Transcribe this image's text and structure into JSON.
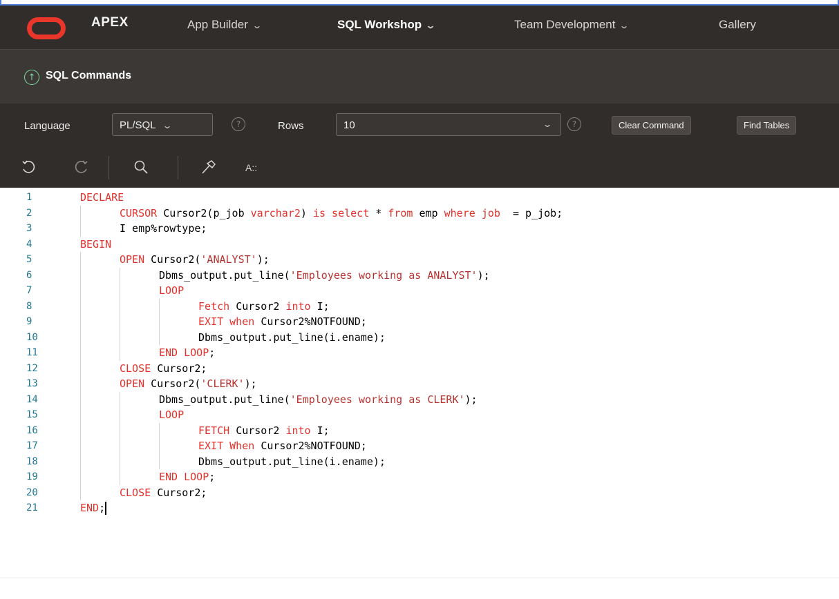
{
  "nav": {
    "brand": "APEX",
    "items": [
      {
        "label": "App Builder",
        "has_menu": true
      },
      {
        "label": "SQL Workshop",
        "has_menu": true,
        "active": true
      },
      {
        "label": "Team Development",
        "has_menu": true
      },
      {
        "label": "Gallery",
        "has_menu": false
      }
    ]
  },
  "page": {
    "title": "SQL Commands"
  },
  "options": {
    "language_label": "Language",
    "language_value": "PL/SQL",
    "rows_label": "Rows",
    "rows_value": "10",
    "help_glyph": "?",
    "clear_button": "Clear Command",
    "find_tables_button": "Find Tables"
  },
  "editor_toolbar": {
    "icons": [
      "undo-icon",
      "redo-icon",
      "search-icon",
      "hammer-icon",
      "text-format-icon"
    ],
    "format_label": "A::"
  },
  "editor": {
    "lines": [
      {
        "n": "1",
        "indent": 0,
        "tokens": [
          [
            "kw",
            "DECLARE"
          ]
        ]
      },
      {
        "n": "2",
        "indent": 1,
        "tokens": [
          [
            "kw",
            "CURSOR "
          ],
          [
            "plain",
            "Cursor2(p_job "
          ],
          [
            "kw",
            "varchar2"
          ],
          [
            "plain",
            ") "
          ],
          [
            "kw",
            "is select"
          ],
          [
            "plain",
            " * "
          ],
          [
            "kw",
            "from"
          ],
          [
            "plain",
            " emp "
          ],
          [
            "kw",
            "where"
          ],
          [
            "plain",
            " "
          ],
          [
            "kw",
            "job"
          ],
          [
            "plain",
            "  = p_job;"
          ]
        ]
      },
      {
        "n": "3",
        "indent": 1,
        "tokens": [
          [
            "plain",
            "I emp%rowtype;"
          ]
        ]
      },
      {
        "n": "4",
        "indent": 0,
        "tokens": [
          [
            "kw",
            "BEGIN"
          ]
        ]
      },
      {
        "n": "5",
        "indent": 1,
        "tokens": [
          [
            "kw",
            "OPEN "
          ],
          [
            "plain",
            "Cursor2("
          ],
          [
            "str",
            "'ANALYST'"
          ],
          [
            "plain",
            ");"
          ]
        ]
      },
      {
        "n": "6",
        "indent": 2,
        "tokens": [
          [
            "plain",
            "Dbms_output.put_line("
          ],
          [
            "str",
            "'Employees working as ANALYST'"
          ],
          [
            "plain",
            ");"
          ]
        ]
      },
      {
        "n": "7",
        "indent": 2,
        "tokens": [
          [
            "kw",
            "LOOP"
          ]
        ]
      },
      {
        "n": "8",
        "indent": 3,
        "tokens": [
          [
            "kw",
            "Fetch "
          ],
          [
            "plain",
            "Cursor2 "
          ],
          [
            "kw",
            "into"
          ],
          [
            "plain",
            " I;"
          ]
        ]
      },
      {
        "n": "9",
        "indent": 3,
        "tokens": [
          [
            "kw",
            "EXIT when "
          ],
          [
            "plain",
            "Cursor2%NOTFOUND;"
          ]
        ]
      },
      {
        "n": "10",
        "indent": 3,
        "tokens": [
          [
            "plain",
            "Dbms_output.put_line(i.ename);"
          ]
        ]
      },
      {
        "n": "11",
        "indent": 2,
        "tokens": [
          [
            "kw",
            "END LOOP"
          ],
          [
            "plain",
            ";"
          ]
        ]
      },
      {
        "n": "12",
        "indent": 1,
        "tokens": [
          [
            "kw",
            "CLOSE "
          ],
          [
            "plain",
            "Cursor2;"
          ]
        ]
      },
      {
        "n": "13",
        "indent": 1,
        "tokens": [
          [
            "kw",
            "OPEN "
          ],
          [
            "plain",
            "Cursor2("
          ],
          [
            "str",
            "'CLERK'"
          ],
          [
            "plain",
            ");"
          ]
        ]
      },
      {
        "n": "14",
        "indent": 2,
        "tokens": [
          [
            "plain",
            "Dbms_output.put_line("
          ],
          [
            "str",
            "'Employees working as CLERK'"
          ],
          [
            "plain",
            ");"
          ]
        ]
      },
      {
        "n": "15",
        "indent": 2,
        "tokens": [
          [
            "kw",
            "LOOP"
          ]
        ]
      },
      {
        "n": "16",
        "indent": 3,
        "tokens": [
          [
            "kw",
            "FETCH "
          ],
          [
            "plain",
            "Cursor2 "
          ],
          [
            "kw",
            "into"
          ],
          [
            "plain",
            " I;"
          ]
        ]
      },
      {
        "n": "17",
        "indent": 3,
        "tokens": [
          [
            "kw",
            "EXIT When "
          ],
          [
            "plain",
            "Cursor2%NOTFOUND;"
          ]
        ]
      },
      {
        "n": "18",
        "indent": 3,
        "tokens": [
          [
            "plain",
            "Dbms_output.put_line(i.ename);"
          ]
        ]
      },
      {
        "n": "19",
        "indent": 2,
        "tokens": [
          [
            "kw",
            "END LOOP"
          ],
          [
            "plain",
            ";"
          ]
        ]
      },
      {
        "n": "20",
        "indent": 1,
        "tokens": [
          [
            "kw",
            "CLOSE "
          ],
          [
            "plain",
            "Cursor2;"
          ]
        ]
      },
      {
        "n": "21",
        "indent": 0,
        "tokens": [
          [
            "kw",
            "END"
          ],
          [
            "plain",
            ";"
          ]
        ]
      }
    ]
  },
  "colors": {
    "nav_bg": "#312d2a",
    "title_bg": "#3c3835",
    "keyword": "#e4312b",
    "string": "#b8312f",
    "line_number": "#237893",
    "logo": "#e8362a",
    "up_icon": "#7cd8a2"
  }
}
